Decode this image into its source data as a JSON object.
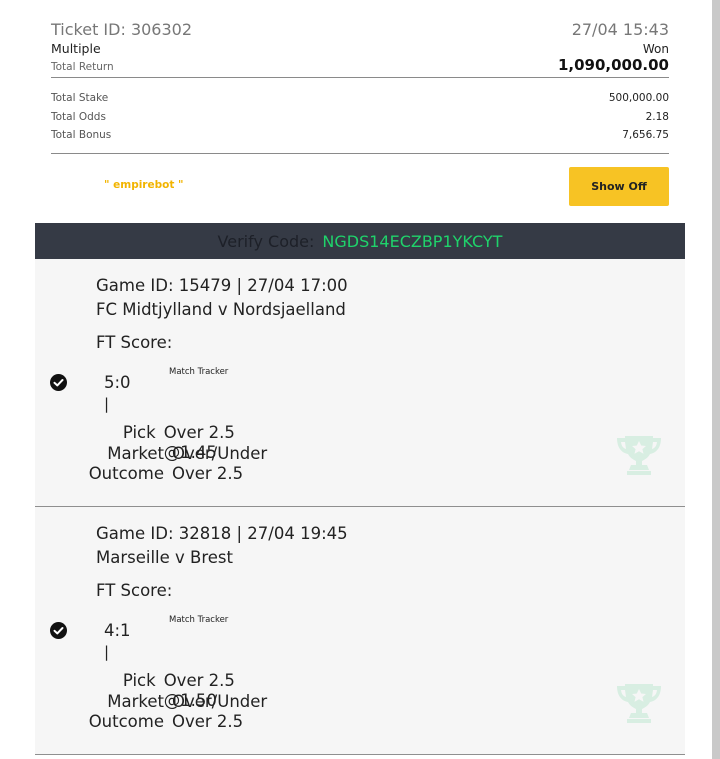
{
  "ticket": {
    "id_label": "Ticket ID: 306302",
    "date": "27/04 15:43",
    "type": "Multiple",
    "status": "Won",
    "total_return_label": "Total Return",
    "total_return": "1,090,000.00"
  },
  "stats": [
    {
      "label": "Total Stake",
      "value": "500,000.00"
    },
    {
      "label": "Total Odds",
      "value": "2.18"
    },
    {
      "label": "Total Bonus",
      "value": "7,656.75"
    }
  ],
  "brand": "\" empirebot \"",
  "show_off_label": "Show Off",
  "verify": {
    "label": "Verify Code:",
    "code": "NGDS14ECZBP1YKCYT"
  },
  "games": [
    {
      "id_line": "Game ID: 15479 | 27/04 17:00",
      "match": "FC Midtjylland v Nordsjaelland",
      "ft_label": "FT Score:",
      "score": "5:0",
      "pipe": "|",
      "tracker": "Match Tracker",
      "pick_label": "Pick",
      "pick": "Over 2.5 @1.45",
      "market_label": "Market",
      "market": "Over/Under",
      "outcome_label": "Outcome",
      "outcome": "Over 2.5"
    },
    {
      "id_line": "Game ID: 32818 | 27/04 19:45",
      "match": "Marseille v Brest",
      "ft_label": "FT Score:",
      "score": "4:1",
      "pipe": "|",
      "tracker": "Match Tracker",
      "pick_label": "Pick",
      "pick": "Over 2.5 @1.50",
      "market_label": "Market",
      "market": "Over/Under",
      "outcome_label": "Outcome",
      "outcome": "Over 2.5"
    }
  ],
  "colors": {
    "accent": "#f7c324",
    "code": "#1fd36b",
    "bar": "#353a45",
    "trophy": "#d8eee2"
  },
  "icons": {
    "check": "check-circle-icon",
    "trophy": "trophy-icon"
  }
}
